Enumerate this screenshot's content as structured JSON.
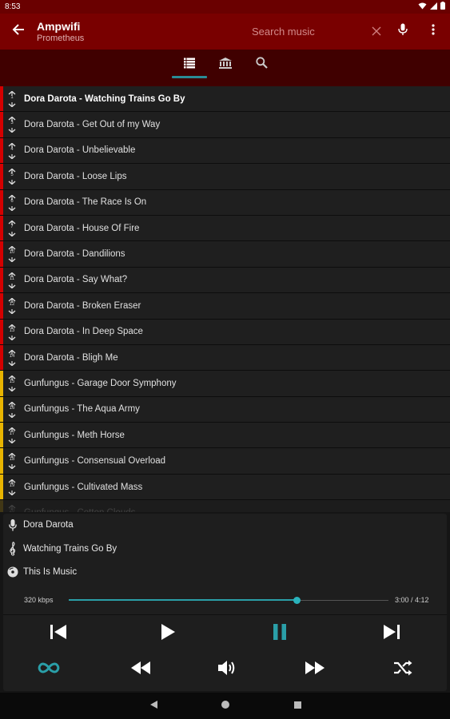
{
  "status": {
    "time": "8:53",
    "icons": [
      "wifi-icon",
      "signal-icon",
      "battery-icon"
    ]
  },
  "appbar": {
    "title": "Ampwifi",
    "subtitle": "Prometheus",
    "search_placeholder": "Search music",
    "search_value": "",
    "icons": [
      "back-arrow-icon",
      "clear-icon",
      "mic-icon",
      "more-vert-icon"
    ]
  },
  "tabs": [
    {
      "icon": "queue-list-icon",
      "selected": true
    },
    {
      "icon": "library-icon",
      "selected": false
    },
    {
      "icon": "search-icon",
      "selected": false
    }
  ],
  "colors": {
    "accent": "#2a9fa8",
    "appbar": "#790000",
    "statusbar": "#6a0000",
    "tabbar": "#400000",
    "artist_red": "#d40000",
    "artist_yellow": "#e8b400"
  },
  "playlist": [
    {
      "num": "1",
      "label": "Dora Darota - Watching Trains Go By",
      "color": "#d40000",
      "active": true
    },
    {
      "num": "3",
      "label": "Dora Darota - Get Out of my Way",
      "color": "#d40000"
    },
    {
      "num": "4",
      "label": "Dora Darota - Unbelievable",
      "color": "#d40000"
    },
    {
      "num": "5",
      "label": "Dora Darota - Loose Lips",
      "color": "#d40000"
    },
    {
      "num": "6",
      "label": "Dora Darota - The Race Is On",
      "color": "#d40000"
    },
    {
      "num": "7",
      "label": "Dora Darota - House Of Fire",
      "color": "#d40000"
    },
    {
      "num": "10",
      "label": "Dora Darota - Dandilions",
      "color": "#d40000"
    },
    {
      "num": "11",
      "label": "Dora Darota - Say What?",
      "color": "#d40000"
    },
    {
      "num": "12",
      "label": "Dora Darota - Broken Eraser",
      "color": "#d40000"
    },
    {
      "num": "13",
      "label": "Dora Darota - In Deep Space",
      "color": "#d40000"
    },
    {
      "num": "14",
      "label": "Dora Darota - Bligh Me",
      "color": "#d40000"
    },
    {
      "num": "15",
      "label": "Gunfungus - Garage Door Symphony",
      "color": "#e8b400"
    },
    {
      "num": "16",
      "label": "Gunfungus - The Aqua Army",
      "color": "#e8b400"
    },
    {
      "num": "17",
      "label": "Gunfungus - Meth Horse",
      "color": "#e8b400"
    },
    {
      "num": "18",
      "label": "Gunfungus - Consensual Overload",
      "color": "#e8b400"
    },
    {
      "num": "19",
      "label": "Gunfungus - Cultivated Mass",
      "color": "#e8b400"
    },
    {
      "num": "20",
      "label": "Gunfungus - Cotton Clouds",
      "color": "#e8b400",
      "faded": true
    }
  ],
  "now_playing": {
    "artist": "Dora Darota",
    "title": "Watching Trains Go By",
    "album": "This Is Music",
    "bitrate": "320 kbps",
    "elapsed": "3:00",
    "duration": "4:12",
    "time_display": "3:00 / 4:12",
    "progress": 0.714,
    "icons": [
      "mic-icon",
      "treble-clef-icon",
      "disc-icon"
    ]
  },
  "controls": {
    "row1": [
      "skip-previous-icon",
      "play-icon",
      "pause-icon",
      "skip-next-icon"
    ],
    "row2": [
      "repeat-infinite-icon",
      "rewind-icon",
      "volume-icon",
      "fast-forward-icon",
      "shuffle-icon"
    ]
  },
  "system_nav": [
    "back-triangle-icon",
    "home-circle-icon",
    "recents-square-icon"
  ]
}
